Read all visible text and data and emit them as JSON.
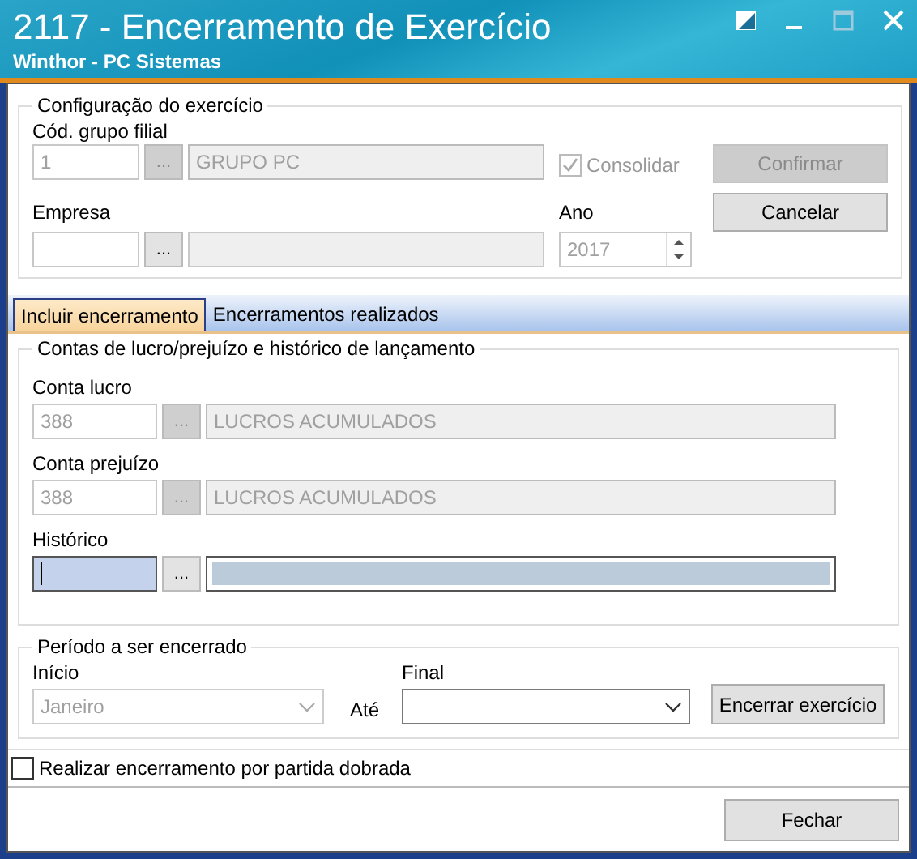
{
  "window": {
    "title": "2117 - Encerramento de Exercício",
    "subtitle": "Winthor - PC Sistemas"
  },
  "config": {
    "legend": "Configuração do exercício",
    "grupo": {
      "label": "Cód. grupo filial",
      "code": "1",
      "button": "...",
      "description": "GRUPO PC",
      "disabled": true
    },
    "empresa": {
      "label": "Empresa",
      "button": "..."
    },
    "consolidar": {
      "label": "Consolidar",
      "checked": true,
      "disabled": true
    },
    "ano": {
      "label": "Ano",
      "value": "2017",
      "disabled": true
    },
    "buttons": [
      {
        "label": "Confirmar",
        "disabled": true
      },
      {
        "label": "Cancelar",
        "disabled": false
      }
    ]
  },
  "tabs": [
    {
      "label": "Incluir encerramento",
      "selected": true
    },
    {
      "label": "Encerramentos realizados",
      "selected": false
    }
  ],
  "contas": {
    "legend": "Contas de lucro/prejuízo e histórico de lançamento",
    "fields": [
      {
        "label": "Conta lucro",
        "code": "388",
        "button": "...",
        "description": "LUCROS ACUMULADOS",
        "disabled": true,
        "focused": false
      },
      {
        "label": "Conta prejuízo",
        "code": "388",
        "button": "...",
        "description": "LUCROS ACUMULADOS",
        "disabled": true,
        "focused": false
      },
      {
        "label": "Histórico",
        "button": "...",
        "disabled": false,
        "focused": true
      }
    ]
  },
  "periodo": {
    "legend": "Período a ser encerrado",
    "inicio": {
      "label": "Início",
      "value": "Janeiro",
      "disabled": true
    },
    "ate": "Até",
    "final": {
      "label": "Final",
      "disabled": false
    },
    "button": {
      "label": "Encerrar exercício",
      "disabled": false
    }
  },
  "partida_dobrada": {
    "label": "Realizar encerramento por partida dobrada",
    "checked": false
  },
  "footer": {
    "button": {
      "label": "Fechar",
      "disabled": false
    }
  }
}
